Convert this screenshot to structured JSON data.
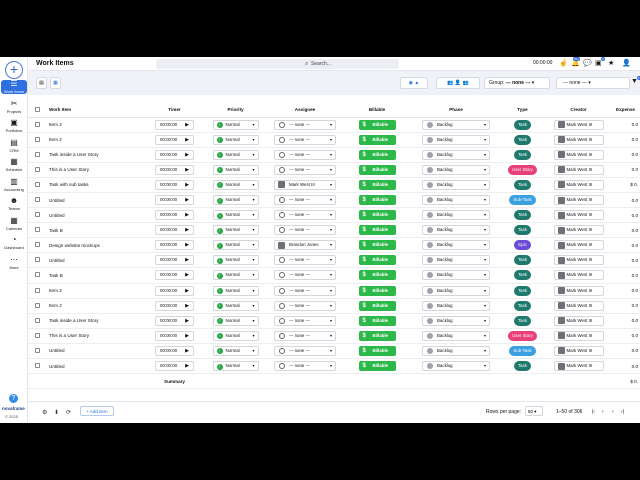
{
  "app": {
    "page_title": "Work Items",
    "search_placeholder": "Search...",
    "timer": "00:00:00",
    "notif_count": "99+",
    "update_badge": "4"
  },
  "sidebar": {
    "items": [
      {
        "label": "Work Items",
        "icon": "list-icon"
      },
      {
        "label": "Projects",
        "icon": "tools-icon"
      },
      {
        "label": "Portfolios",
        "icon": "briefcase-icon"
      },
      {
        "label": "CRM",
        "icon": "contact-card-icon"
      },
      {
        "label": "Schedule",
        "icon": "calendar-icon"
      },
      {
        "label": "Accounting",
        "icon": "ledger-icon"
      },
      {
        "label": "Teams",
        "icon": "people-icon"
      },
      {
        "label": "Calendar",
        "icon": "calendar-icon"
      },
      {
        "label": "Dashboard",
        "icon": "gauge-icon"
      },
      {
        "label": "More",
        "icon": "more-icon"
      }
    ],
    "brand": "novaframe",
    "copyright": "© 2025"
  },
  "toolbar": {
    "group_label": "Group:",
    "group_value": "--- none ---",
    "filter_value": "--- none ---",
    "filter_badge": "1"
  },
  "columns": [
    "Work Item",
    "Timer",
    "Priority",
    "Assignee",
    "Billable",
    "Phase",
    "Type",
    "Creator",
    "Expense"
  ],
  "rows": [
    {
      "name": "Item 2",
      "timer": "00:00:00",
      "priority": "Normal",
      "assignee": "--- none ---",
      "billable": "Billable",
      "phase": "Backlog",
      "type": "Task",
      "creator": "Mark West III",
      "expense": "0.0"
    },
    {
      "name": "Item 2",
      "timer": "00:00:00",
      "priority": "Normal",
      "assignee": "--- none ---",
      "billable": "Billable",
      "phase": "Backlog",
      "type": "Task",
      "creator": "Mark West III",
      "expense": "0.0"
    },
    {
      "name": "Task inside a User Story",
      "timer": "00:00:00",
      "priority": "Normal",
      "assignee": "--- none ---",
      "billable": "Billable",
      "phase": "Backlog",
      "type": "Task",
      "creator": "Mark West III",
      "expense": "0.0"
    },
    {
      "name": "This is a User Story",
      "timer": "00:00:00",
      "priority": "Normal",
      "assignee": "--- none ---",
      "billable": "Billable",
      "phase": "Backlog",
      "type": "User Story",
      "creator": "Mark West III",
      "expense": "0.0"
    },
    {
      "name": "Task with sub tasks",
      "timer": "00:00:00",
      "priority": "Normal",
      "assignee": "Mark West III",
      "billable": "Billable",
      "phase": "Backlog",
      "type": "Task",
      "creator": "Mark West III",
      "expense": "$ 0."
    },
    {
      "name": "Untitled",
      "timer": "00:00:00",
      "priority": "Normal",
      "assignee": "--- none ---",
      "billable": "Billable",
      "phase": "Backlog",
      "type": "Sub-Task",
      "creator": "Mark West III",
      "expense": "0.0"
    },
    {
      "name": "Untitled",
      "timer": "00:00:00",
      "priority": "Normal",
      "assignee": "--- none ---",
      "billable": "Billable",
      "phase": "Backlog",
      "type": "Task",
      "creator": "Mark West III",
      "expense": "0.0"
    },
    {
      "name": "Task B",
      "timer": "00:00:00",
      "priority": "Normal",
      "assignee": "--- none ---",
      "billable": "Billable",
      "phase": "Backlog",
      "type": "Task",
      "creator": "Mark West III",
      "expense": "0.0"
    },
    {
      "name": "Design website mockups",
      "timer": "00:00:00",
      "priority": "Normal",
      "assignee": "Brandon Jones",
      "billable": "Billable",
      "phase": "Backlog",
      "type": "Epic",
      "creator": "Mark West III",
      "expense": "0.0"
    },
    {
      "name": "Untitled",
      "timer": "00:00:00",
      "priority": "Normal",
      "assignee": "--- none ---",
      "billable": "Billable",
      "phase": "Backlog",
      "type": "Task",
      "creator": "Mark West III",
      "expense": "0.0"
    },
    {
      "name": "Task B",
      "timer": "00:00:00",
      "priority": "Normal",
      "assignee": "--- none ---",
      "billable": "Billable",
      "phase": "Backlog",
      "type": "Task",
      "creator": "Mark West III",
      "expense": "0.0"
    },
    {
      "name": "Item 2",
      "timer": "00:00:00",
      "priority": "Normal",
      "assignee": "--- none ---",
      "billable": "Billable",
      "phase": "Backlog",
      "type": "Task",
      "creator": "Mark West III",
      "expense": "0.0"
    },
    {
      "name": "Item 2",
      "timer": "00:00:00",
      "priority": "Normal",
      "assignee": "--- none ---",
      "billable": "Billable",
      "phase": "Backlog",
      "type": "Task",
      "creator": "Mark West III",
      "expense": "0.0"
    },
    {
      "name": "Task inside a User Story",
      "timer": "00:00:00",
      "priority": "Normal",
      "assignee": "--- none ---",
      "billable": "Billable",
      "phase": "Backlog",
      "type": "Task",
      "creator": "Mark West III",
      "expense": "0.0"
    },
    {
      "name": "This is a User Story",
      "timer": "00:00:00",
      "priority": "Normal",
      "assignee": "--- none ---",
      "billable": "Billable",
      "phase": "Backlog",
      "type": "User Story",
      "creator": "Mark West III",
      "expense": "0.0"
    },
    {
      "name": "Untitled",
      "timer": "00:00:00",
      "priority": "Normal",
      "assignee": "--- none ---",
      "billable": "Billable",
      "phase": "Backlog",
      "type": "Sub-Task",
      "creator": "Mark West III",
      "expense": "0.0"
    },
    {
      "name": "Untitled",
      "timer": "00:00:00",
      "priority": "Normal",
      "assignee": "--- none ---",
      "billable": "Billable",
      "phase": "Backlog",
      "type": "Task",
      "creator": "Mark West III",
      "expense": "0.0"
    }
  ],
  "type_colors": {
    "Task": "#1d7a6d",
    "User Story": "#e8417a",
    "Sub-Task": "#3aa0e0",
    "Epic": "#6b4bd6"
  },
  "summary": {
    "label": "Summary",
    "expense": "$ 0."
  },
  "footer": {
    "add_item": "+ Add item",
    "rows_per_page_label": "Rows per page:",
    "rows_per_page": "50",
    "range": "1–50 of 306"
  }
}
